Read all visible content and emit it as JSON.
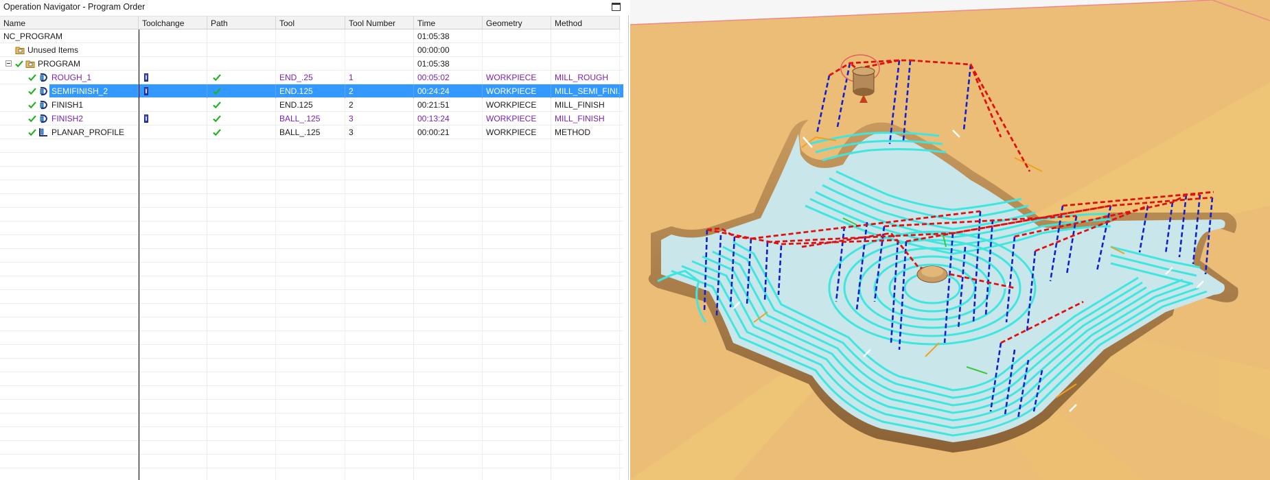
{
  "panel": {
    "title": "Operation Navigator - Program Order"
  },
  "columns": [
    "Name",
    "Toolchange",
    "Path",
    "Tool",
    "Tool Number",
    "Time",
    "Geometry",
    "Method"
  ],
  "rows": [
    {
      "name": "NC_PROGRAM",
      "toolchange": "",
      "path": "",
      "tool": "",
      "tool_number": "",
      "time": "01:05:38",
      "geometry": "",
      "method": ""
    },
    {
      "name": "Unused Items",
      "toolchange": "",
      "path": "",
      "tool": "",
      "tool_number": "",
      "time": "00:00:00",
      "geometry": "",
      "method": ""
    },
    {
      "name": "PROGRAM",
      "toolchange": "",
      "path": "",
      "tool": "",
      "tool_number": "",
      "time": "01:05:38",
      "geometry": "",
      "method": ""
    },
    {
      "name": "ROUGH_1",
      "toolchange": "toolchange-icon",
      "path": "check-icon",
      "tool": "END_.25",
      "tool_number": "1",
      "time": "00:05:02",
      "geometry": "WORKPIECE",
      "method": "MILL_ROUGH"
    },
    {
      "name": "SEMIFINISH_2",
      "toolchange": "toolchange-icon",
      "path": "check-icon",
      "tool": "END.125",
      "tool_number": "2",
      "time": "00:24:24",
      "geometry": "WORKPIECE",
      "method": "MILL_SEMI_FINI..."
    },
    {
      "name": "FINISH1",
      "toolchange": "",
      "path": "check-icon",
      "tool": "END.125",
      "tool_number": "2",
      "time": "00:21:51",
      "geometry": "WORKPIECE",
      "method": "MILL_FINISH"
    },
    {
      "name": "FINISH2",
      "toolchange": "toolchange-icon",
      "path": "check-icon",
      "tool": "BALL_.125",
      "tool_number": "3",
      "time": "00:13:24",
      "geometry": "WORKPIECE",
      "method": "MILL_FINISH"
    },
    {
      "name": "PLANAR_PROFILE",
      "toolchange": "",
      "path": "check-icon",
      "tool": "BALL_.125",
      "tool_number": "3",
      "time": "00:00:21",
      "geometry": "WORKPIECE",
      "method": "METHOD"
    }
  ],
  "selected_row": "SEMIFINISH_2",
  "colors": {
    "selection": "#3399ff",
    "changed_text": "#7a1fb8",
    "check": "#22b322",
    "stock": "#eab86c",
    "toolpath_cut": "#3fe6e0",
    "toolpath_rapid": "#e01010",
    "toolpath_plunge": "#1020d0"
  },
  "icons": {
    "status": "check-icon",
    "operation": "mill-operation-icon",
    "program_group": "program-group-icon",
    "planar": "planar-profile-icon"
  }
}
